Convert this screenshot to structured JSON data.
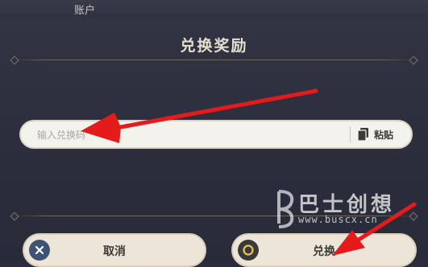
{
  "top_tab": {
    "label": "账户"
  },
  "dialog": {
    "title": "兑换奖励",
    "input": {
      "placeholder": "输入兑换码",
      "value": ""
    },
    "paste": {
      "label": "粘贴",
      "icon": "clipboard-icon"
    },
    "cancel": {
      "label": "取消",
      "icon": "close-circle-icon"
    },
    "confirm": {
      "label": "兑换",
      "icon": "ring-circle-icon"
    }
  },
  "watermark": {
    "brand": "巴士创想",
    "url": "www.buscx.cn"
  },
  "annotation": {
    "color": "#e41b1b"
  }
}
